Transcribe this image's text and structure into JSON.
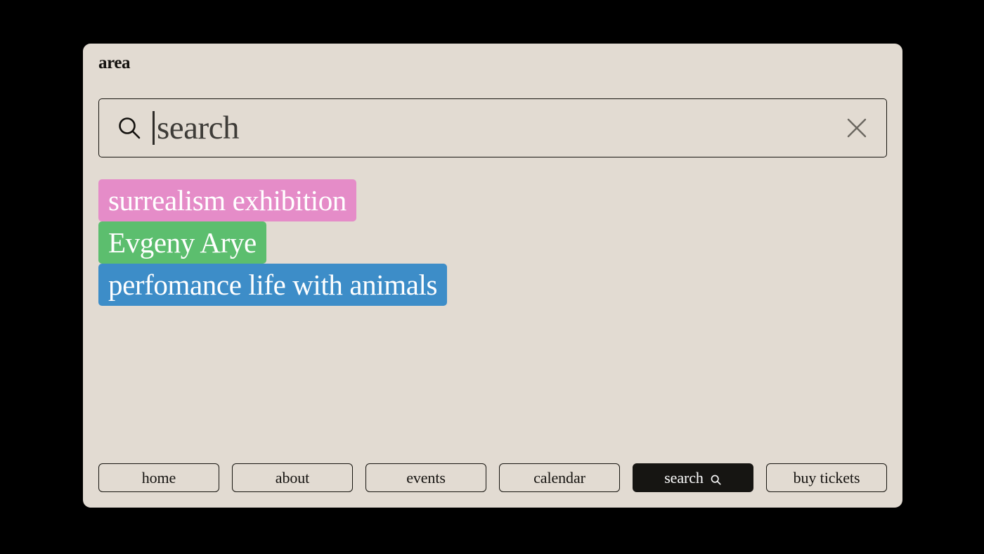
{
  "theme": {
    "page_background": "#000000",
    "panel_background": "#E2DBD2",
    "ink": "#14120F",
    "active_nav_background": "#161512"
  },
  "header": {
    "logo": "area"
  },
  "search": {
    "placeholder": "search",
    "value": "",
    "caret_visible": true,
    "search_icon": "search-icon",
    "clear_icon": "close-icon"
  },
  "suggestions": {
    "items": [
      {
        "label": "surrealism exhibition",
        "color": "#E58CC8"
      },
      {
        "label": "Evgeny Arye",
        "color": "#5CBE6E"
      },
      {
        "label": "perfomance life with animals",
        "color": "#3D8DC8"
      }
    ]
  },
  "nav": {
    "items": [
      {
        "label": "home",
        "active": false,
        "icon": ""
      },
      {
        "label": "about",
        "active": false,
        "icon": ""
      },
      {
        "label": "events",
        "active": false,
        "icon": ""
      },
      {
        "label": "calendar",
        "active": false,
        "icon": ""
      },
      {
        "label": "search",
        "active": true,
        "icon": "search-icon"
      },
      {
        "label": "buy tickets",
        "active": false,
        "icon": ""
      }
    ]
  }
}
